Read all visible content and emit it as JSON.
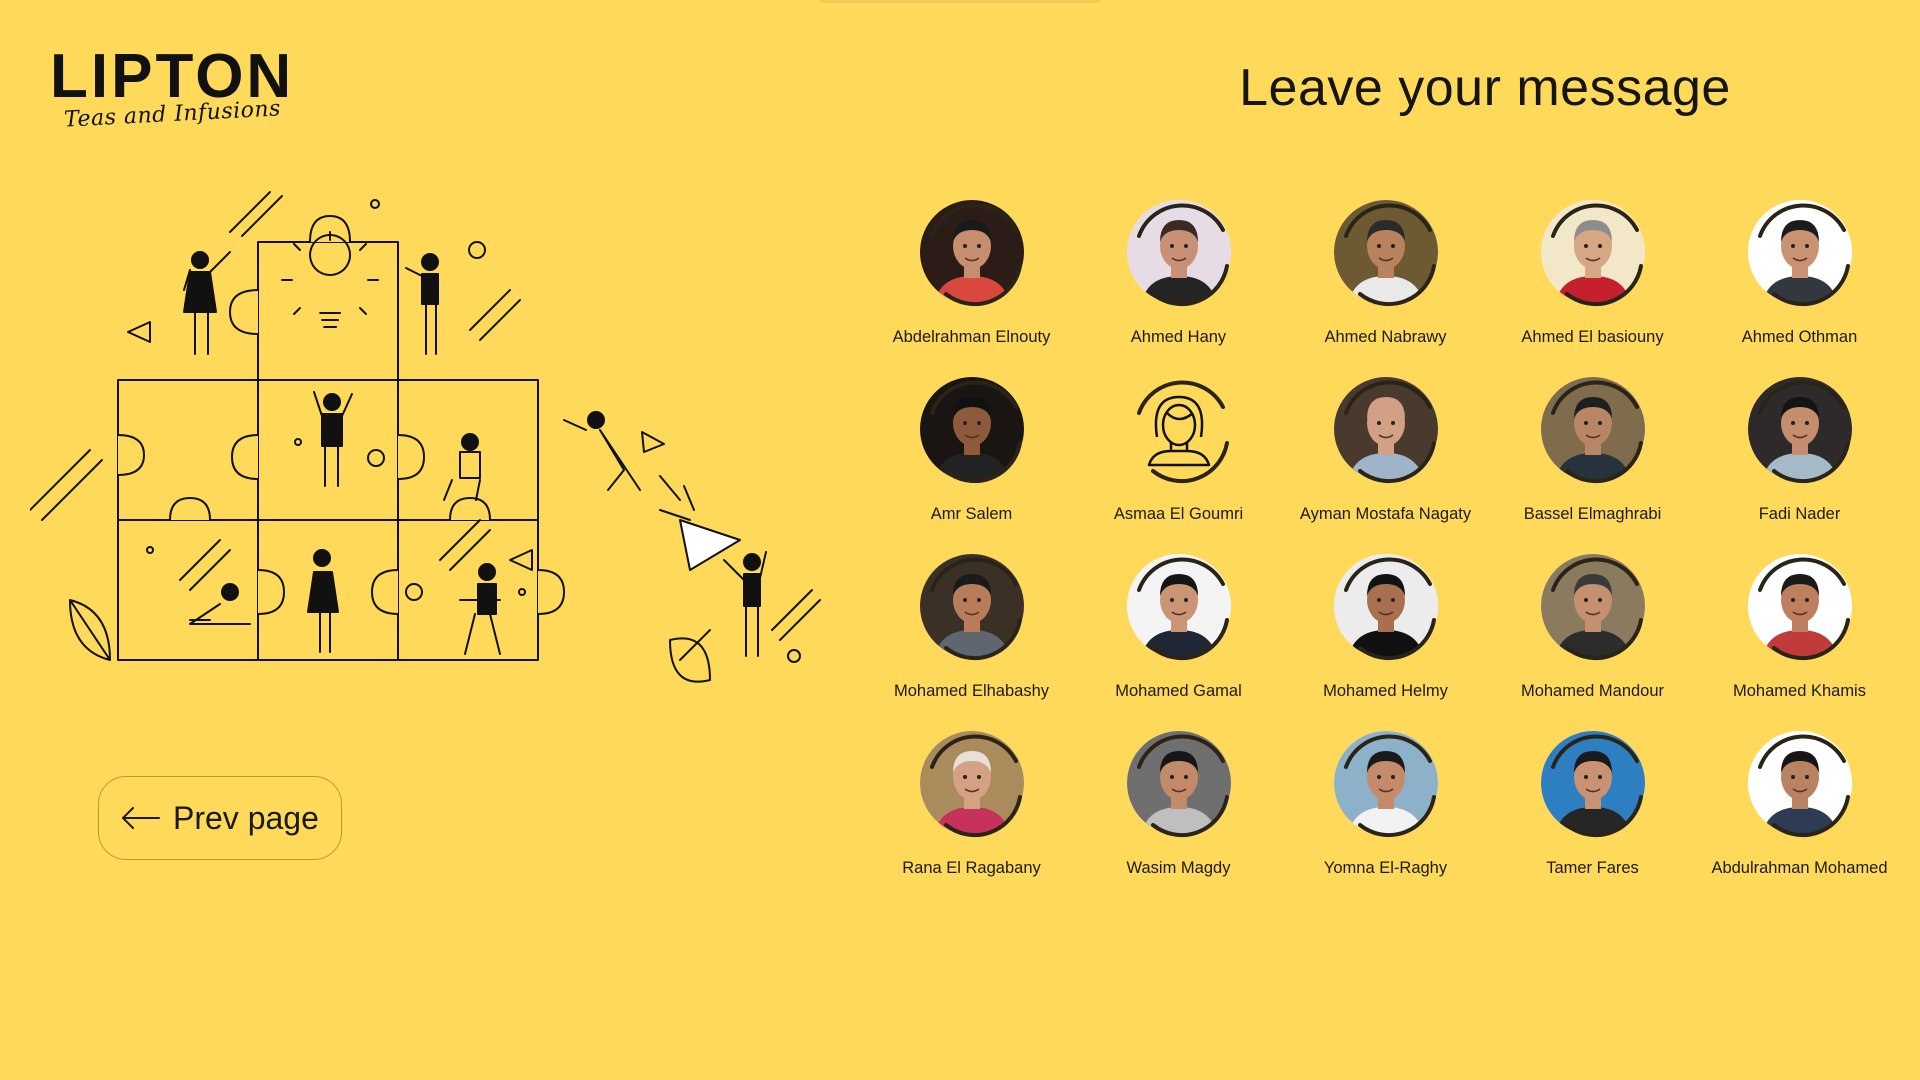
{
  "brand": {
    "name": "LIPTON",
    "tagline": "Teas and Infusions"
  },
  "page_title": "Leave your message",
  "nav": {
    "prev_label": "Prev page"
  },
  "colors": {
    "background": "#FFD95A",
    "text": "#151515",
    "button_border": "#B79A34"
  },
  "members": [
    {
      "name": "Abdelrahman Elnouty",
      "avatar": "photo",
      "bg": "#2b1c17",
      "skin": "#c58e6f",
      "shirt": "#d9473f",
      "hair": "#1a1a1a"
    },
    {
      "name": "Ahmed Hany",
      "avatar": "photo",
      "bg": "#e7dbe6",
      "skin": "#c89176",
      "shirt": "#242424",
      "hair": "#3b2a22"
    },
    {
      "name": "Ahmed Nabrawy",
      "avatar": "photo",
      "bg": "#6d5a33",
      "skin": "#b9825e",
      "shirt": "#e9e9e9",
      "hair": "#2b2b2b"
    },
    {
      "name": "Ahmed El basiouny",
      "avatar": "photo",
      "bg": "#f2e7c6",
      "skin": "#d5a785",
      "shirt": "#c4202e",
      "hair": "#8d8d8d"
    },
    {
      "name": "Ahmed Othman",
      "avatar": "photo",
      "bg": "#ffffff",
      "skin": "#c99373",
      "shirt": "#333840",
      "hair": "#1c1c1c"
    },
    {
      "name": "Amr Salem",
      "avatar": "photo",
      "bg": "#1a1512",
      "skin": "#8d5a3c",
      "shirt": "#222222",
      "hair": "#111111"
    },
    {
      "name": "Asmaa El Goumri",
      "avatar": "placeholder",
      "bg": "#FFD95A",
      "skin": "#FFD95A",
      "shirt": "#FFD95A",
      "hair": "#111111"
    },
    {
      "name": "Ayman Mostafa Nagaty",
      "avatar": "photo",
      "bg": "#4a3a2e",
      "skin": "#d2a084",
      "shirt": "#9fb4c9",
      "hair": "#d2a084"
    },
    {
      "name": "Bassel Elmaghrabi",
      "avatar": "photo",
      "bg": "#7e6c4c",
      "skin": "#b98665",
      "shirt": "#26323c",
      "hair": "#1f1f1f"
    },
    {
      "name": "Fadi Nader",
      "avatar": "photo",
      "bg": "#2e2a2a",
      "skin": "#c48d6d",
      "shirt": "#a6b9c9",
      "hair": "#141414"
    },
    {
      "name": "Mohamed Elhabashy",
      "avatar": "photo",
      "bg": "#3a3026",
      "skin": "#b77d5b",
      "shirt": "#5f6670",
      "hair": "#1b1b1b"
    },
    {
      "name": "Mohamed Gamal",
      "avatar": "photo",
      "bg": "#f4f4f4",
      "skin": "#c99574",
      "shirt": "#1e2733",
      "hair": "#151515"
    },
    {
      "name": "Mohamed Helmy",
      "avatar": "photo",
      "bg": "#ececec",
      "skin": "#a8704f",
      "shirt": "#101010",
      "hair": "#121212"
    },
    {
      "name": "Mohamed Mandour",
      "avatar": "photo",
      "bg": "#8a7a5e",
      "skin": "#c49070",
      "shirt": "#2c2c2c",
      "hair": "#3a3a3a"
    },
    {
      "name": "Mohamed Khamis",
      "avatar": "photo",
      "bg": "#ffffff",
      "skin": "#bd7f5e",
      "shirt": "#c23b3b",
      "hair": "#1a1a1a"
    },
    {
      "name": "Rana El Ragabany",
      "avatar": "photo",
      "bg": "#a98b5c",
      "skin": "#d4a282",
      "shirt": "#c6325b",
      "hair": "#e6e0d6"
    },
    {
      "name": "Wasim Magdy",
      "avatar": "photo",
      "bg": "#6f6f6f",
      "skin": "#c18b6a",
      "shirt": "#bfbfbf",
      "hair": "#161616"
    },
    {
      "name": "Yomna El-Raghy",
      "avatar": "photo",
      "bg": "#8db1c8",
      "skin": "#c48a69",
      "shirt": "#f2f2f2",
      "hair": "#1a1a1a"
    },
    {
      "name": "Tamer Fares",
      "avatar": "photo",
      "bg": "#2d7fc2",
      "skin": "#c99272",
      "shirt": "#262626",
      "hair": "#1a1a1a"
    },
    {
      "name": "Abdulrahman Mohamed",
      "avatar": "photo",
      "bg": "#ffffff",
      "skin": "#b98262",
      "shirt": "#2e3b55",
      "hair": "#151515"
    }
  ]
}
